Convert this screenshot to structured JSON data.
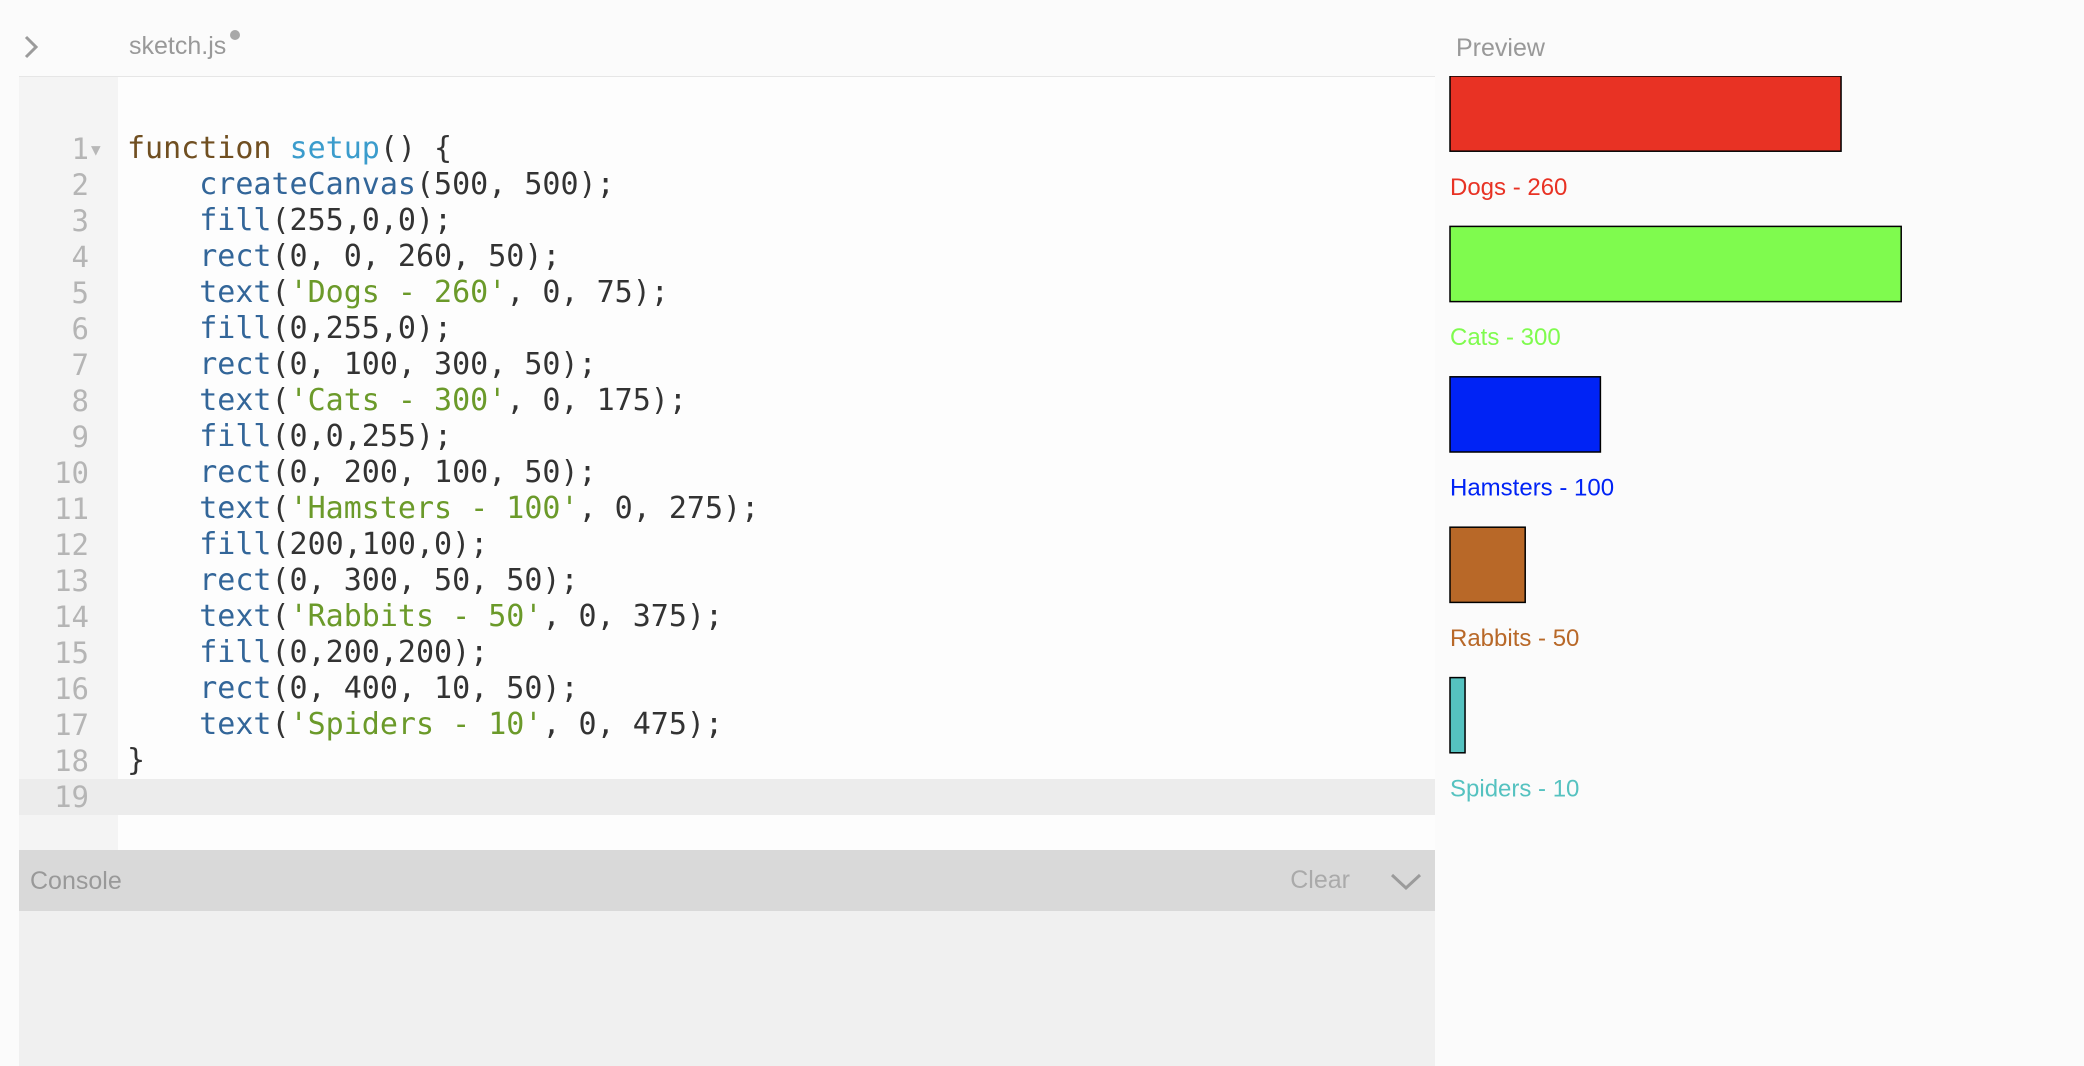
{
  "tab": {
    "file_name": "sketch.js"
  },
  "preview": {
    "label": "Preview"
  },
  "console": {
    "title": "Console",
    "clear_label": "Clear"
  },
  "code": {
    "lines": [
      [
        {
          "t": "kw",
          "s": "function "
        },
        {
          "t": "fn",
          "s": "setup"
        },
        {
          "t": "p",
          "s": "() {"
        }
      ],
      [
        {
          "t": "p",
          "s": "    "
        },
        {
          "t": "builtin",
          "s": "createCanvas"
        },
        {
          "t": "p",
          "s": "(500, 500);"
        }
      ],
      [
        {
          "t": "p",
          "s": "    "
        },
        {
          "t": "builtin",
          "s": "fill"
        },
        {
          "t": "p",
          "s": "(255,0,0);"
        }
      ],
      [
        {
          "t": "p",
          "s": "    "
        },
        {
          "t": "builtin",
          "s": "rect"
        },
        {
          "t": "p",
          "s": "(0, 0, 260, 50);"
        }
      ],
      [
        {
          "t": "p",
          "s": "    "
        },
        {
          "t": "builtin",
          "s": "text"
        },
        {
          "t": "p",
          "s": "("
        },
        {
          "t": "str",
          "s": "'Dogs - 260'"
        },
        {
          "t": "p",
          "s": ", 0, 75);"
        }
      ],
      [
        {
          "t": "p",
          "s": "    "
        },
        {
          "t": "builtin",
          "s": "fill"
        },
        {
          "t": "p",
          "s": "(0,255,0);"
        }
      ],
      [
        {
          "t": "p",
          "s": "    "
        },
        {
          "t": "builtin",
          "s": "rect"
        },
        {
          "t": "p",
          "s": "(0, 100, 300, 50);"
        }
      ],
      [
        {
          "t": "p",
          "s": "    "
        },
        {
          "t": "builtin",
          "s": "text"
        },
        {
          "t": "p",
          "s": "("
        },
        {
          "t": "str",
          "s": "'Cats - 300'"
        },
        {
          "t": "p",
          "s": ", 0, 175);"
        }
      ],
      [
        {
          "t": "p",
          "s": "    "
        },
        {
          "t": "builtin",
          "s": "fill"
        },
        {
          "t": "p",
          "s": "(0,0,255);"
        }
      ],
      [
        {
          "t": "p",
          "s": "    "
        },
        {
          "t": "builtin",
          "s": "rect"
        },
        {
          "t": "p",
          "s": "(0, 200, 100, 50);"
        }
      ],
      [
        {
          "t": "p",
          "s": "    "
        },
        {
          "t": "builtin",
          "s": "text"
        },
        {
          "t": "p",
          "s": "("
        },
        {
          "t": "str",
          "s": "'Hamsters - 100'"
        },
        {
          "t": "p",
          "s": ", 0, 275);"
        }
      ],
      [
        {
          "t": "p",
          "s": "    "
        },
        {
          "t": "builtin",
          "s": "fill"
        },
        {
          "t": "p",
          "s": "(200,100,0);"
        }
      ],
      [
        {
          "t": "p",
          "s": "    "
        },
        {
          "t": "builtin",
          "s": "rect"
        },
        {
          "t": "p",
          "s": "(0, 300, 50, 50);"
        }
      ],
      [
        {
          "t": "p",
          "s": "    "
        },
        {
          "t": "builtin",
          "s": "text"
        },
        {
          "t": "p",
          "s": "("
        },
        {
          "t": "str",
          "s": "'Rabbits - 50'"
        },
        {
          "t": "p",
          "s": ", 0, 375);"
        }
      ],
      [
        {
          "t": "p",
          "s": "    "
        },
        {
          "t": "builtin",
          "s": "fill"
        },
        {
          "t": "p",
          "s": "(0,200,200);"
        }
      ],
      [
        {
          "t": "p",
          "s": "    "
        },
        {
          "t": "builtin",
          "s": "rect"
        },
        {
          "t": "p",
          "s": "(0, 400, 10, 50);"
        }
      ],
      [
        {
          "t": "p",
          "s": "    "
        },
        {
          "t": "builtin",
          "s": "text"
        },
        {
          "t": "p",
          "s": "("
        },
        {
          "t": "str",
          "s": "'Spiders - 10'"
        },
        {
          "t": "p",
          "s": ", 0, 475);"
        }
      ],
      [
        {
          "t": "p",
          "s": "}"
        }
      ],
      []
    ]
  },
  "chart_data": {
    "type": "bar",
    "categories": [
      "Dogs - 260",
      "Cats - 300",
      "Hamsters - 100",
      "Rabbits - 50",
      "Spiders - 10"
    ],
    "values": [
      260,
      300,
      100,
      50,
      10
    ],
    "colors": [
      "#e83224",
      "#7ffb4e",
      "#0023f5",
      "#b86828",
      "#55c2c0"
    ]
  }
}
